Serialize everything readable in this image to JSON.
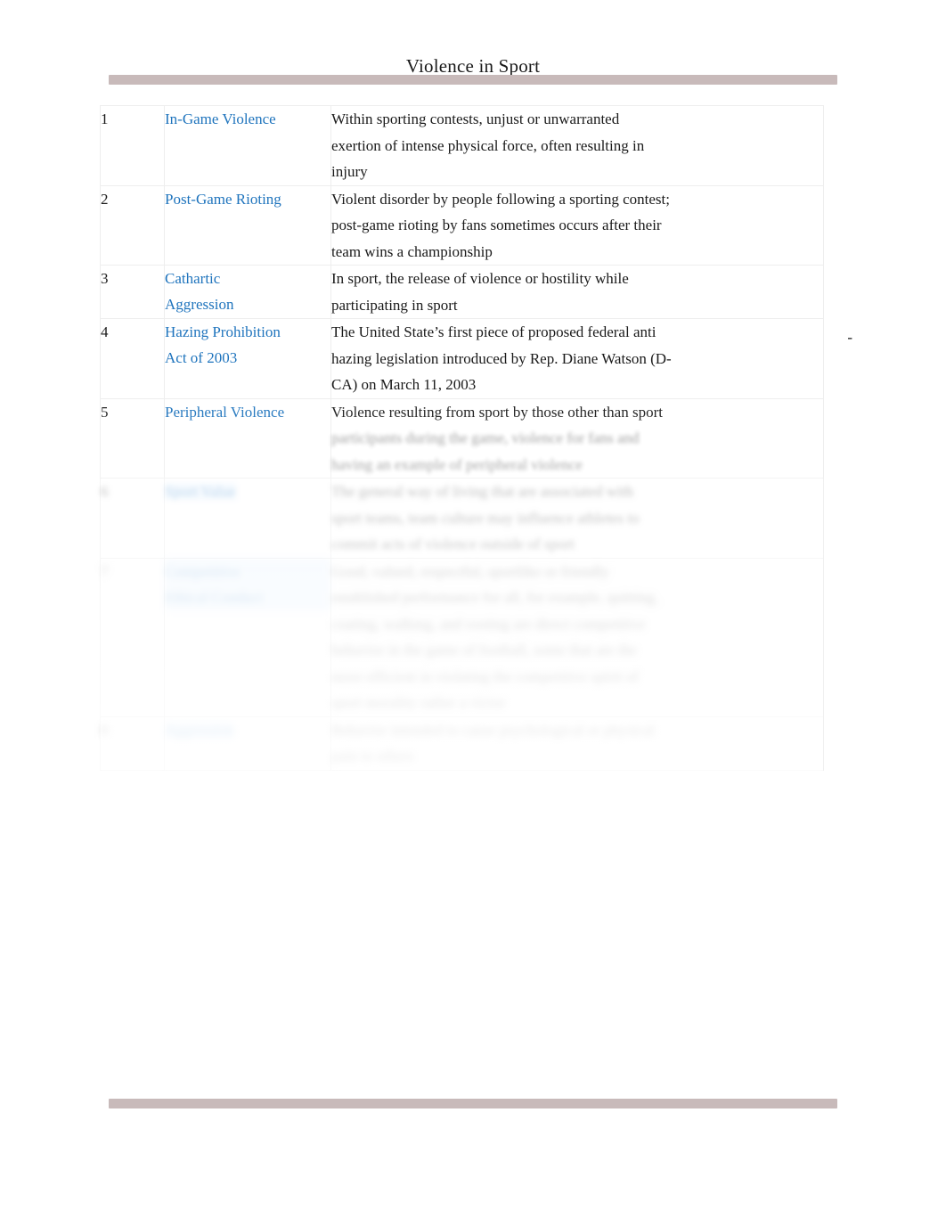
{
  "document": {
    "title": "Violence in Sport",
    "accent_blue": "#1f74bd",
    "rule_bar_color": "#c8baba",
    "body_text_color": "#1a1a1a"
  },
  "rows": [
    {
      "num": "1",
      "term": "In-Game Violence",
      "def_lines": [
        "Within sporting contests, unjust or unwarranted",
        "exertion of intense physical force, often resulting in",
        "injury"
      ],
      "trailing_mark": ""
    },
    {
      "num": "2",
      "term": "Post-Game Rioting",
      "def_lines": [
        "Violent disorder by people following a sporting contest;",
        "post-game rioting by fans sometimes occurs after their",
        "team wins a championship"
      ],
      "trailing_mark": ""
    },
    {
      "num": "3",
      "term": "Cathartic Aggression",
      "term_lines": [
        "Cathartic",
        "Aggression"
      ],
      "def_lines": [
        "In sport, the release of violence or hostility while",
        "participating in sport"
      ],
      "trailing_mark": ""
    },
    {
      "num": "4",
      "term": "Hazing Prohibition Act of 2003",
      "term_lines": [
        "Hazing Prohibition",
        "Act of 2003"
      ],
      "def_lines": [
        "The United State’s first piece of proposed federal anti",
        "hazing legislation introduced by Rep. Diane Watson (D-",
        "CA) on March 11, 2003"
      ],
      "trailing_mark": "-"
    },
    {
      "num": "5",
      "term": "Peripheral Violence",
      "def_lines": [
        "Violence resulting from sport by those other than sport",
        "participants during the game, violence for fans and",
        "having an example of peripheral violence"
      ],
      "trailing_mark": ""
    },
    {
      "num": "6",
      "term": "Sport Value",
      "def_lines": [
        "The general way of living that are associated with",
        "sport teams, team culture may influence athletes to",
        "commit acts of violence outside of sport"
      ],
      "trailing_mark": ""
    },
    {
      "num": "7",
      "term": "Competitive Ethical Conduct",
      "term_lines": [
        "Competitive",
        "Ethical Conduct"
      ],
      "def_lines": [
        "Good, valued, respectful, sportlike or friendly",
        "established performance for all, for example, quitting,",
        "coating, walking, and rooting are direct competitive",
        "behavior in the game of football, some that are the",
        "more efficient in violating the competitive spirit of",
        "sport morality rather a victor"
      ],
      "trailing_mark": ""
    },
    {
      "num": "8",
      "term": "Aggression",
      "def_lines": [
        "Behavior intended to cause psychological or physical",
        "pain to others"
      ],
      "trailing_mark": ""
    }
  ]
}
